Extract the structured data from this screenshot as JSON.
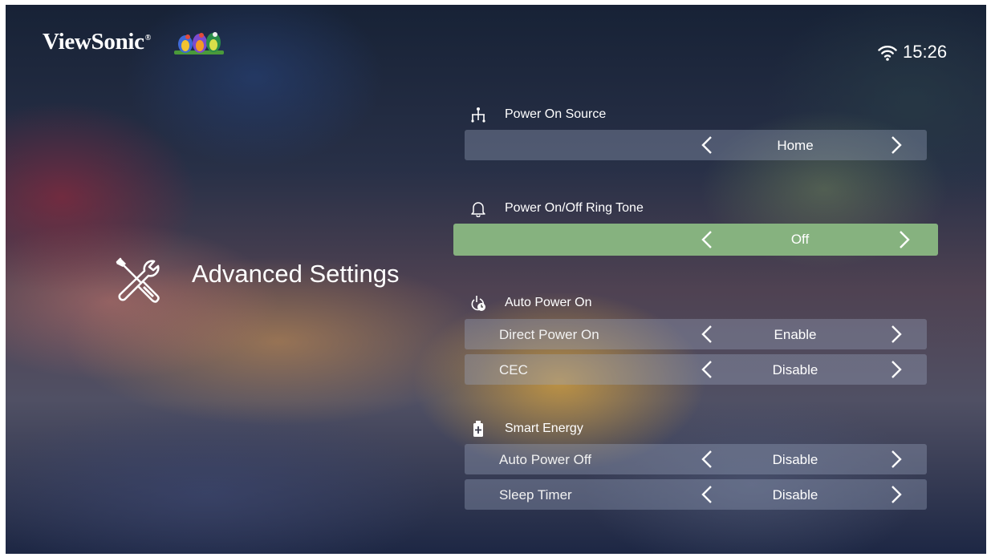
{
  "header": {
    "brand": "ViewSonic",
    "brand_mark": "®",
    "time": "15:26",
    "wifi_icon": "wifi-icon",
    "logo_icon": "birds-logo"
  },
  "page": {
    "title": "Advanced Settings",
    "icon": "tools-icon"
  },
  "groups": [
    {
      "label": "Power On Source",
      "icon": "source-tree-icon",
      "rows": [
        {
          "label": "",
          "value": "Home"
        }
      ]
    },
    {
      "label": "Power On/Off Ring Tone",
      "icon": "bell-icon",
      "rows": [
        {
          "label": "",
          "value": "Off",
          "focused": true
        }
      ]
    },
    {
      "label": "Auto Power On",
      "icon": "power-clock-icon",
      "rows": [
        {
          "label": "Direct Power On",
          "value": "Enable"
        },
        {
          "label": "CEC",
          "value": "Disable"
        }
      ]
    },
    {
      "label": "Smart Energy",
      "icon": "battery-icon",
      "rows": [
        {
          "label": "Auto Power Off",
          "value": "Disable"
        },
        {
          "label": "Sleep Timer",
          "value": "Disable"
        }
      ]
    }
  ],
  "colors": {
    "focus": "#86b27f",
    "row": "rgba(155,165,190,0.36)",
    "text": "#ffffff"
  }
}
